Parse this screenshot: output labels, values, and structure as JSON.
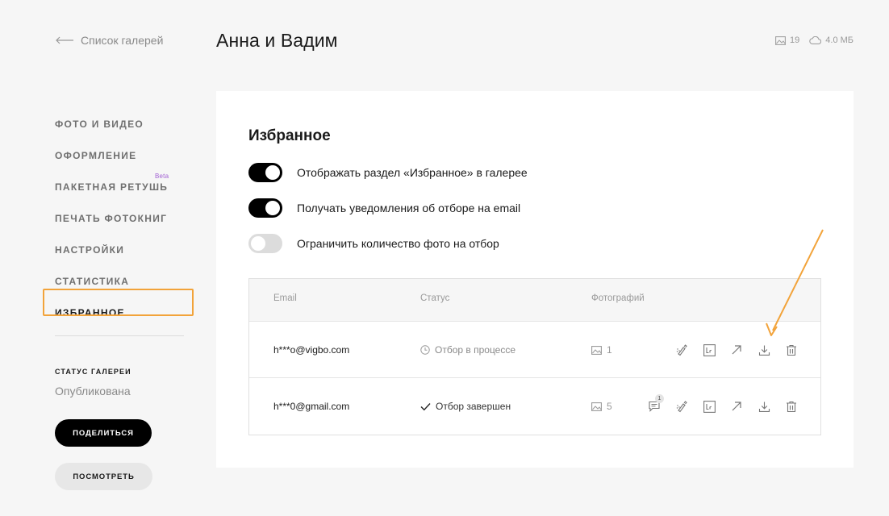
{
  "header": {
    "back_label": "Список галерей",
    "title": "Анна и Вадим",
    "photo_count": "19",
    "storage": "4.0 МБ"
  },
  "sidebar": {
    "items": [
      {
        "label": "Фото и видео"
      },
      {
        "label": "Оформление"
      },
      {
        "label": "Пакетная ретушь",
        "badge": "Beta"
      },
      {
        "label": "Печать фотокниг"
      },
      {
        "label": "Настройки"
      },
      {
        "label": "Статистика"
      },
      {
        "label": "Избранное",
        "active": true
      }
    ],
    "status_heading": "СТАТУС ГАЛЕРЕИ",
    "status_value": "Опубликована",
    "share_label": "Поделиться",
    "view_label": "Посмотреть"
  },
  "favorites": {
    "title": "Избранное",
    "toggles": [
      {
        "label": "Отображать раздел «Избранное» в галерее",
        "on": true
      },
      {
        "label": "Получать уведомления об отборе на email",
        "on": true
      },
      {
        "label": "Ограничить количество фото на отбор",
        "on": false
      }
    ],
    "table": {
      "headers": {
        "email": "Email",
        "status": "Статус",
        "photos": "Фотографий"
      },
      "rows": [
        {
          "email": "h***o@vigbo.com",
          "status": "Отбор в процессе",
          "status_icon": "clock-icon",
          "photos": "1",
          "comments": ""
        },
        {
          "email": "h***0@gmail.com",
          "status": "Отбор завершен",
          "status_icon": "check-icon",
          "photos": "5",
          "comments": "1"
        }
      ]
    }
  },
  "colors": {
    "accent": "#f2a33a",
    "beta": "#a15fd3",
    "toggle_on": "#000000",
    "toggle_off": "#dcdcdc"
  }
}
